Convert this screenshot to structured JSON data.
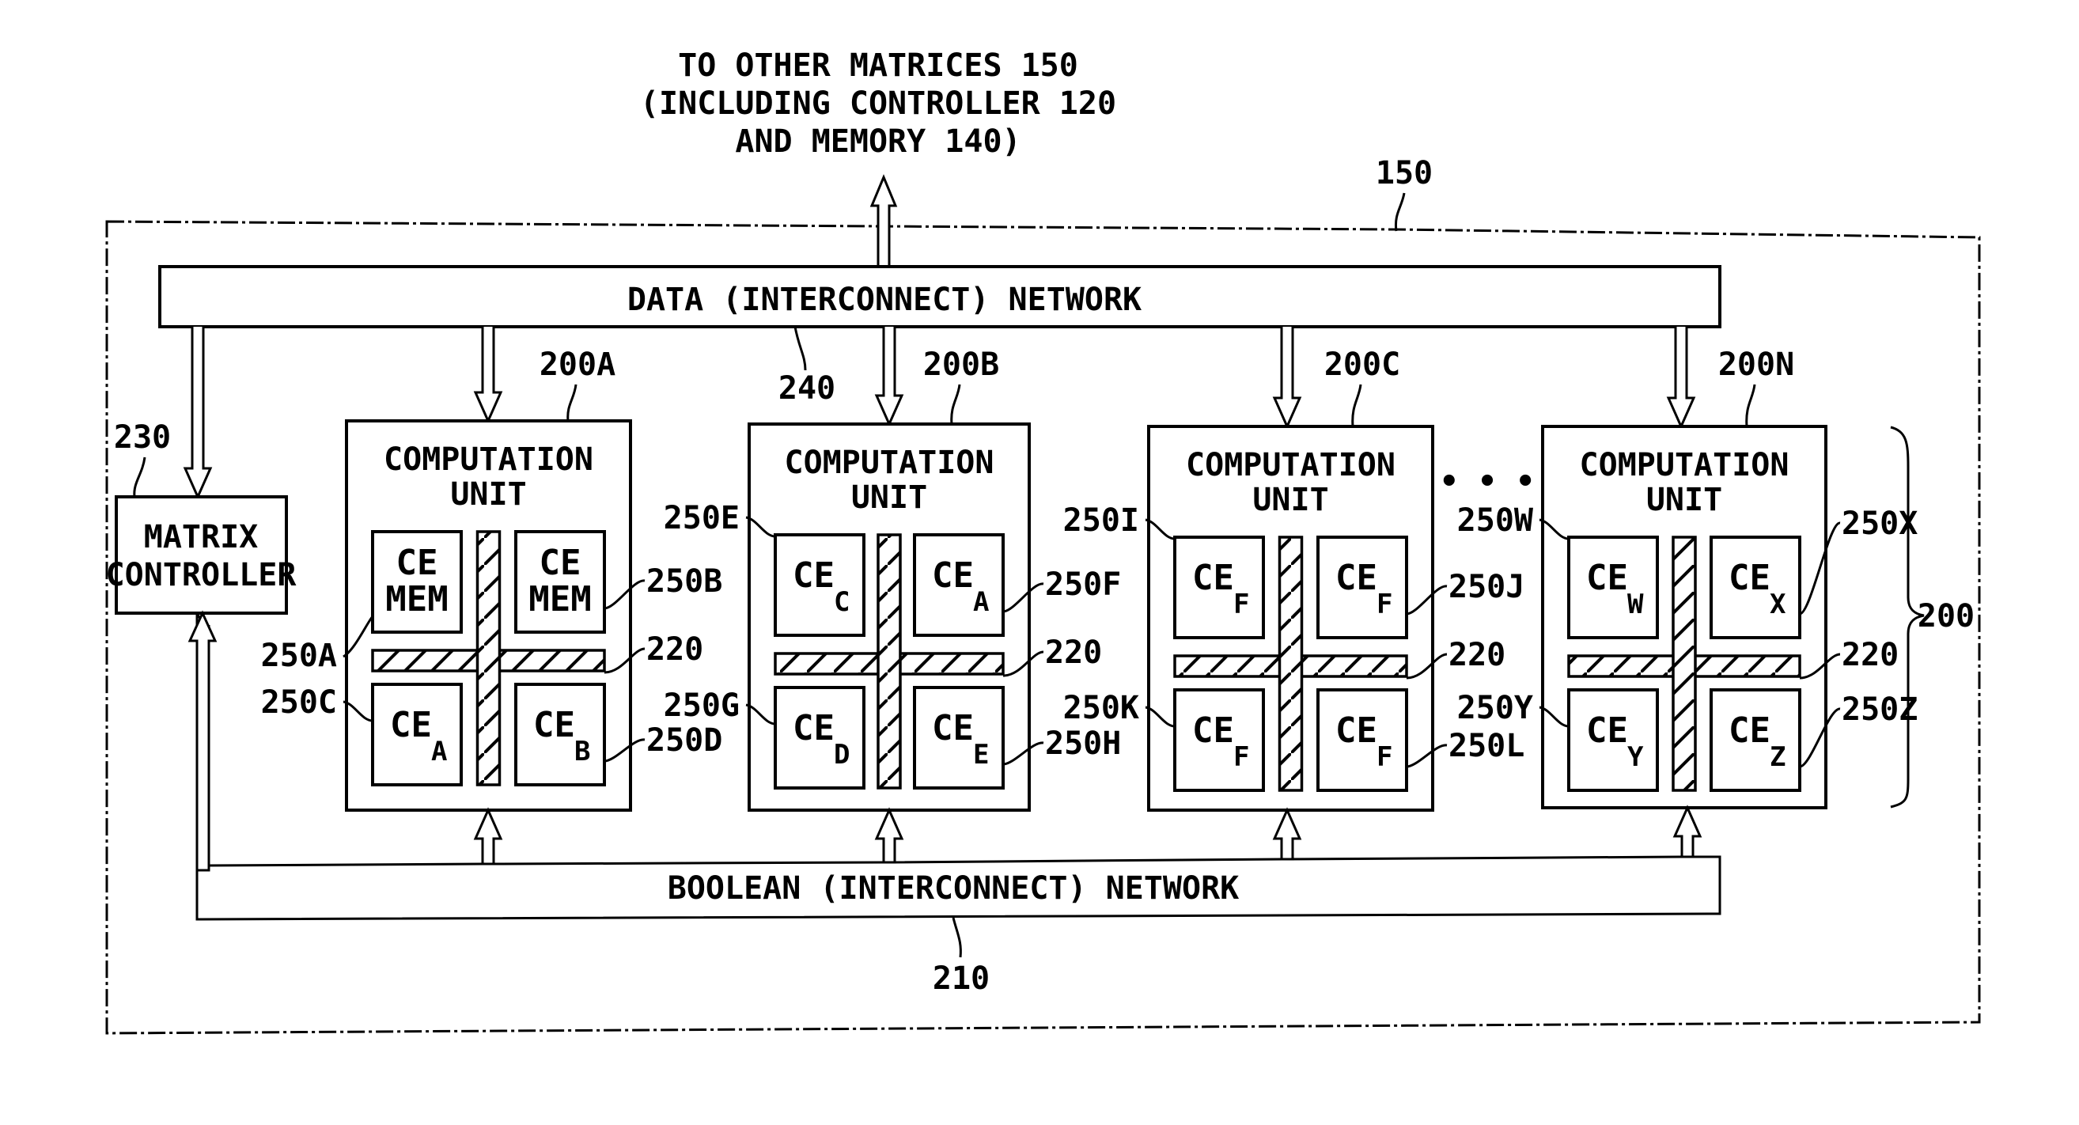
{
  "figure": {
    "external_label": [
      "TO OTHER MATRICES 150",
      "(INCLUDING CONTROLLER 120",
      "AND MEMORY 140)"
    ],
    "matrix_ref": "150",
    "data_network": {
      "label": "DATA (INTERCONNECT) NETWORK",
      "ref": "240"
    },
    "boolean_network": {
      "label": "BOOLEAN (INTERCONNECT) NETWORK",
      "ref": "210"
    },
    "matrix_controller": {
      "label": [
        "MATRIX",
        "CONTROLLER"
      ],
      "ref": "230"
    },
    "units_group_ref": "200",
    "ellipsis": "• • •",
    "units": [
      {
        "ref": "200A",
        "title": [
          "COMPUTATION",
          "UNIT"
        ],
        "interconnect_ref": "220",
        "elements": [
          {
            "ref": "250A",
            "main": "CE",
            "sub": "",
            "second_line": "MEM"
          },
          {
            "ref": "250B",
            "main": "CE",
            "sub": "",
            "second_line": "MEM"
          },
          {
            "ref": "250C",
            "main": "CE",
            "sub": "A",
            "second_line": ""
          },
          {
            "ref": "250D",
            "main": "CE",
            "sub": "B",
            "second_line": ""
          }
        ]
      },
      {
        "ref": "200B",
        "title": [
          "COMPUTATION",
          "UNIT"
        ],
        "interconnect_ref": "220",
        "elements": [
          {
            "ref": "250E",
            "main": "CE",
            "sub": "C",
            "second_line": ""
          },
          {
            "ref": "250F",
            "main": "CE",
            "sub": "A",
            "second_line": ""
          },
          {
            "ref": "250G",
            "main": "CE",
            "sub": "D",
            "second_line": ""
          },
          {
            "ref": "250H",
            "main": "CE",
            "sub": "E",
            "second_line": ""
          }
        ]
      },
      {
        "ref": "200C",
        "title": [
          "COMPUTATION",
          "UNIT"
        ],
        "interconnect_ref": "220",
        "elements": [
          {
            "ref": "250I",
            "main": "CE",
            "sub": "F",
            "second_line": ""
          },
          {
            "ref": "250J",
            "main": "CE",
            "sub": "F",
            "second_line": ""
          },
          {
            "ref": "250K",
            "main": "CE",
            "sub": "F",
            "second_line": ""
          },
          {
            "ref": "250L",
            "main": "CE",
            "sub": "F",
            "second_line": ""
          }
        ]
      },
      {
        "ref": "200N",
        "title": [
          "COMPUTATION",
          "UNIT"
        ],
        "interconnect_ref": "220",
        "elements": [
          {
            "ref": "250W",
            "main": "CE",
            "sub": "W",
            "second_line": ""
          },
          {
            "ref": "250X",
            "main": "CE",
            "sub": "X",
            "second_line": ""
          },
          {
            "ref": "250Y",
            "main": "CE",
            "sub": "Y",
            "second_line": ""
          },
          {
            "ref": "250Z",
            "main": "CE",
            "sub": "Z",
            "second_line": ""
          }
        ]
      }
    ]
  }
}
